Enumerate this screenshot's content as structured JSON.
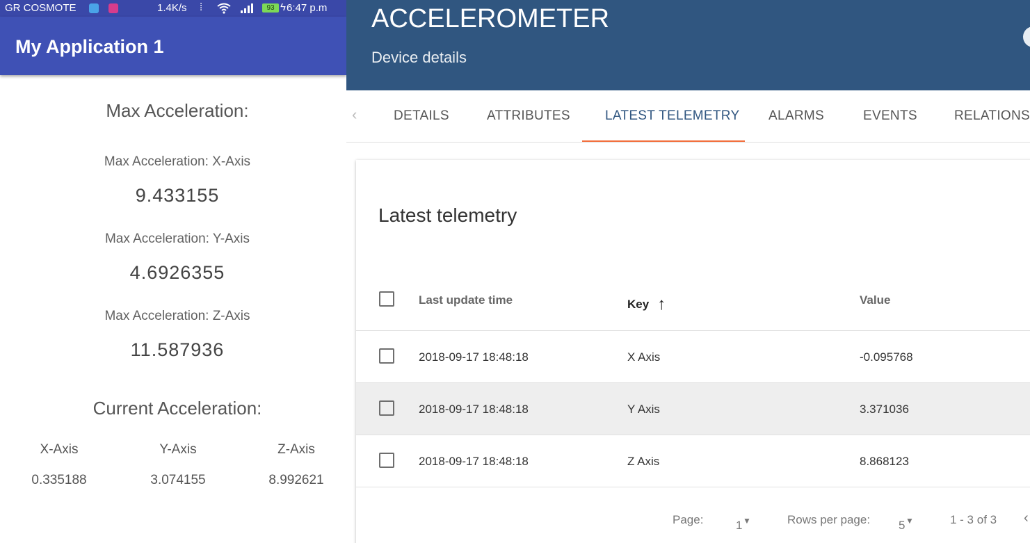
{
  "phone": {
    "status_bar": {
      "carrier": "GR COSMOTE",
      "speed": "1.4K/s",
      "battery": "93",
      "time": "6:47 p.m"
    },
    "app_title": "My Application 1",
    "max_section_title": "Max Acceleration:",
    "max_items": [
      {
        "label": "Max Acceleration: X-Axis",
        "value": "9.433155"
      },
      {
        "label": "Max Acceleration: Y-Axis",
        "value": "4.6926355"
      },
      {
        "label": "Max Acceleration: Z-Axis",
        "value": "11.587936"
      }
    ],
    "current_section_title": "Current Acceleration:",
    "current_axes": [
      {
        "label": "X-Axis",
        "value": "0.335188"
      },
      {
        "label": "Y-Axis",
        "value": "3.074155"
      },
      {
        "label": "Z-Axis",
        "value": "8.992621"
      }
    ]
  },
  "thingsboard": {
    "title": "ACCELEROMETER",
    "subtitle": "Device details",
    "tabs": [
      {
        "label": "DETAILS"
      },
      {
        "label": "ATTRIBUTES"
      },
      {
        "label": "LATEST TELEMETRY",
        "active": true
      },
      {
        "label": "ALARMS"
      },
      {
        "label": "EVENTS"
      },
      {
        "label": "RELATIONS"
      }
    ],
    "card_title": "Latest telemetry",
    "columns": {
      "time": "Last update time",
      "key": "Key",
      "value": "Value"
    },
    "rows": [
      {
        "time": "2018-09-17 18:48:18",
        "key": "X Axis",
        "value": "-0.095768"
      },
      {
        "time": "2018-09-17 18:48:18",
        "key": "Y Axis",
        "value": "3.371036",
        "selected": true
      },
      {
        "time": "2018-09-17 18:48:18",
        "key": "Z Axis",
        "value": "8.868123"
      }
    ],
    "pager": {
      "page_label": "Page:",
      "page_value": "1",
      "rows_label": "Rows per page:",
      "rows_value": "5",
      "range": "1 - 3 of 3"
    }
  },
  "colors": {
    "phone_appbar": "#3f51b5",
    "tb_header": "#305680",
    "tab_ink": "#f26e3c",
    "selected_row": "#eeeeee"
  }
}
